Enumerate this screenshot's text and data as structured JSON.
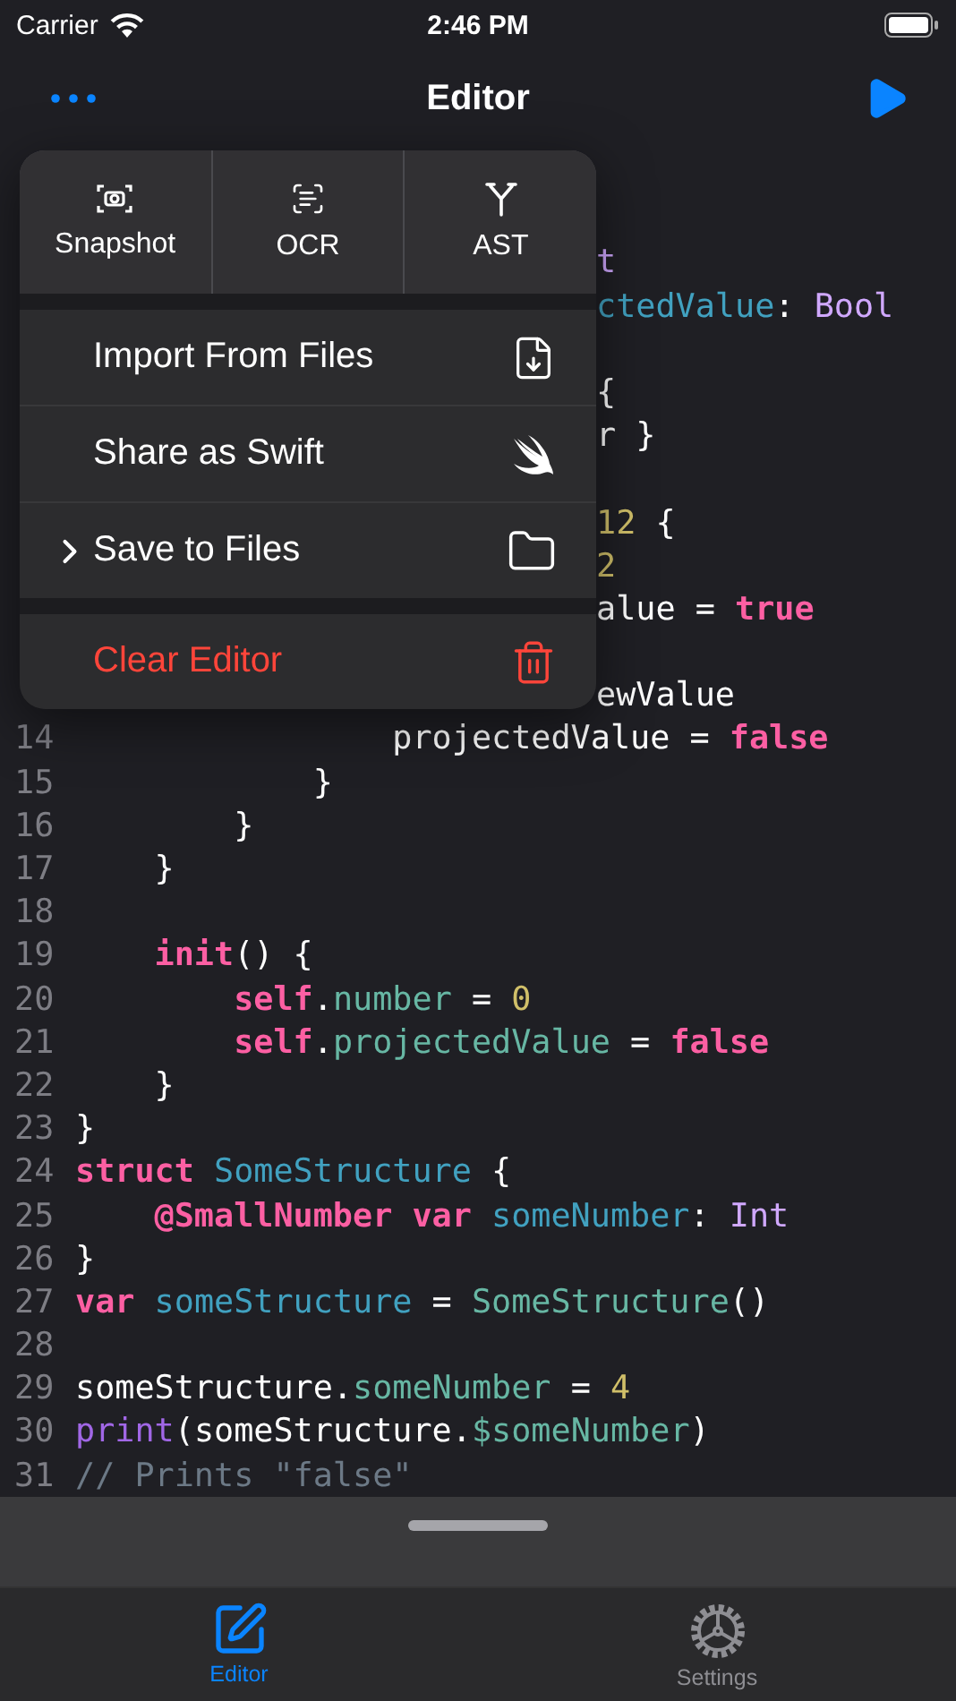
{
  "status_bar": {
    "carrier": "Carrier",
    "time": "2:46 PM"
  },
  "nav_bar": {
    "title": "Editor"
  },
  "code": {
    "lines": [
      {
        "kind": "covered"
      },
      {
        "kind": "covered"
      },
      {
        "kind": "covered",
        "tokens": [
          {
            "kind": "type",
            "text": "t"
          }
        ]
      },
      {
        "kind": "covered",
        "tokens": [
          {
            "kind": "declaration",
            "text": "ctedValue"
          },
          {
            "kind": "plain",
            "text": ": "
          },
          {
            "kind": "type",
            "text": "Bool"
          }
        ]
      },
      {
        "kind": "covered"
      },
      {
        "kind": "covered",
        "tokens": [
          {
            "kind": "plain",
            "text": "{"
          }
        ]
      },
      {
        "kind": "covered",
        "tokens": [
          {
            "kind": "plain",
            "text": "r }"
          }
        ]
      },
      {
        "kind": "covered"
      },
      {
        "kind": "covered",
        "tokens": [
          {
            "kind": "number",
            "text": "12"
          },
          {
            "kind": "plain",
            "text": " {"
          }
        ]
      },
      {
        "kind": "covered",
        "tokens": [
          {
            "kind": "number",
            "text": "2"
          }
        ]
      },
      {
        "kind": "covered",
        "tokens": [
          {
            "kind": "plain",
            "text": "alue = "
          },
          {
            "kind": "keyword",
            "text": "true"
          }
        ]
      },
      {
        "kind": "covered"
      },
      {
        "kind": "covered",
        "tokens": [
          {
            "kind": "plain",
            "text": "ewValue"
          }
        ]
      },
      {
        "kind": "line",
        "number": "14",
        "tokens": [
          {
            "kind": "plain",
            "text": "                projectedValue = "
          },
          {
            "kind": "keyword",
            "text": "false"
          }
        ]
      },
      {
        "kind": "line",
        "number": "15",
        "tokens": [
          {
            "kind": "plain",
            "text": "            }"
          }
        ]
      },
      {
        "kind": "line",
        "number": "16",
        "tokens": [
          {
            "kind": "plain",
            "text": "        }"
          }
        ]
      },
      {
        "kind": "line",
        "number": "17",
        "tokens": [
          {
            "kind": "plain",
            "text": "    }"
          }
        ]
      },
      {
        "kind": "line",
        "number": "18"
      },
      {
        "kind": "line",
        "number": "19",
        "tokens": [
          {
            "kind": "keyword",
            "text": "    init"
          },
          {
            "kind": "plain",
            "text": "() {"
          }
        ]
      },
      {
        "kind": "line",
        "number": "20",
        "tokens": [
          {
            "kind": "keyword",
            "text": "        self"
          },
          {
            "kind": "plain",
            "text": "."
          },
          {
            "kind": "property",
            "text": "number"
          },
          {
            "kind": "plain",
            "text": " = "
          },
          {
            "kind": "number",
            "text": "0"
          }
        ]
      },
      {
        "kind": "line",
        "number": "21",
        "tokens": [
          {
            "kind": "keyword",
            "text": "        self"
          },
          {
            "kind": "plain",
            "text": "."
          },
          {
            "kind": "property",
            "text": "projectedValue"
          },
          {
            "kind": "plain",
            "text": " = "
          },
          {
            "kind": "keyword",
            "text": "false"
          }
        ]
      },
      {
        "kind": "line",
        "number": "22",
        "tokens": [
          {
            "kind": "plain",
            "text": "    }"
          }
        ]
      },
      {
        "kind": "line",
        "number": "23",
        "tokens": [
          {
            "kind": "plain",
            "text": "}"
          }
        ]
      },
      {
        "kind": "line",
        "number": "24",
        "tokens": [
          {
            "kind": "keyword",
            "text": "struct "
          },
          {
            "kind": "declaration",
            "text": "SomeStructure"
          },
          {
            "kind": "plain",
            "text": " {"
          }
        ]
      },
      {
        "kind": "line",
        "number": "25",
        "tokens": [
          {
            "kind": "keyword",
            "text": "    @SmallNumber var "
          },
          {
            "kind": "declaration",
            "text": "someNumber"
          },
          {
            "kind": "plain",
            "text": ": "
          },
          {
            "kind": "type",
            "text": "Int"
          }
        ]
      },
      {
        "kind": "line",
        "number": "26",
        "tokens": [
          {
            "kind": "plain",
            "text": "}"
          }
        ]
      },
      {
        "kind": "line",
        "number": "27",
        "tokens": [
          {
            "kind": "keyword",
            "text": "var "
          },
          {
            "kind": "declaration",
            "text": "someStructure"
          },
          {
            "kind": "plain",
            "text": " = "
          },
          {
            "kind": "property",
            "text": "SomeStructure"
          },
          {
            "kind": "plain",
            "text": "()"
          }
        ]
      },
      {
        "kind": "line",
        "number": "28"
      },
      {
        "kind": "line",
        "number": "29",
        "tokens": [
          {
            "kind": "plain",
            "text": "someStructure."
          },
          {
            "kind": "property",
            "text": "someNumber"
          },
          {
            "kind": "plain",
            "text": " = "
          },
          {
            "kind": "number",
            "text": "4"
          }
        ]
      },
      {
        "kind": "line",
        "number": "30",
        "tokens": [
          {
            "kind": "function",
            "text": "print"
          },
          {
            "kind": "plain",
            "text": "(someStructure."
          },
          {
            "kind": "property",
            "text": "$someNumber"
          },
          {
            "kind": "plain",
            "text": ")"
          }
        ]
      },
      {
        "kind": "line",
        "number": "31",
        "tokens": [
          {
            "kind": "comment",
            "text": "// Prints \"false\""
          }
        ]
      }
    ]
  },
  "menu": {
    "quick_actions": [
      {
        "label": "Snapshot"
      },
      {
        "label": "OCR"
      },
      {
        "label": "AST"
      }
    ],
    "groups": [
      {
        "items": [
          {
            "label": "Import From Files",
            "has_submenu": false,
            "destructive": false
          },
          {
            "label": "Share as Swift",
            "has_submenu": false,
            "destructive": false
          },
          {
            "label": "Save to Files",
            "has_submenu": true,
            "destructive": false
          }
        ]
      },
      {
        "items": [
          {
            "label": "Clear Editor",
            "has_submenu": false,
            "destructive": true
          }
        ]
      }
    ]
  },
  "tab_bar": {
    "tabs": [
      {
        "label": "Editor",
        "selected": true
      },
      {
        "label": "Settings",
        "selected": false
      }
    ]
  }
}
